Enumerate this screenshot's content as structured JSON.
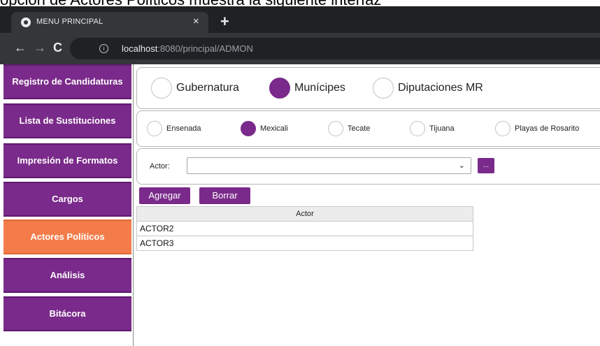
{
  "caption": "opción de Actores Políticos muestra la siguiente interfaz",
  "browser": {
    "tab_title": "MENU PRINCIPAL",
    "tab_close": "×",
    "new_tab": "+",
    "back": "←",
    "forward": "→",
    "reload": "C",
    "url_host": "localhost",
    "url_path": ":8080/principal/ADMON"
  },
  "sidebar": {
    "items": [
      {
        "label": "Registro de Candidaturas",
        "active": false
      },
      {
        "label": "Lista de Sustituciones",
        "active": false
      },
      {
        "label": "Impresión de Formatos",
        "active": false
      },
      {
        "label": "Cargos",
        "active": false
      },
      {
        "label": "Actores Políticos",
        "active": true
      },
      {
        "label": "Análisis",
        "active": false
      },
      {
        "label": "Bitácora",
        "active": false
      }
    ]
  },
  "election_type": {
    "options": [
      "Gubernatura",
      "Munícipes",
      "Diputaciones MR"
    ],
    "selected": "Munícipes"
  },
  "municipality": {
    "options": [
      "Ensenada",
      "Mexicali",
      "Tecate",
      "Tijuana",
      "Playas de Rosarito"
    ],
    "selected": "Mexicali"
  },
  "actor_select": {
    "label": "Actor:",
    "value": "",
    "chevron": "⌄",
    "more_button": "..."
  },
  "buttons": {
    "add": "Agregar",
    "delete": "Borrar"
  },
  "table": {
    "header": "Actor",
    "rows": [
      "ACTOR2",
      "ACTOR3"
    ]
  },
  "colors": {
    "brand": "#7a2a8a",
    "active": "#f47c4a"
  }
}
